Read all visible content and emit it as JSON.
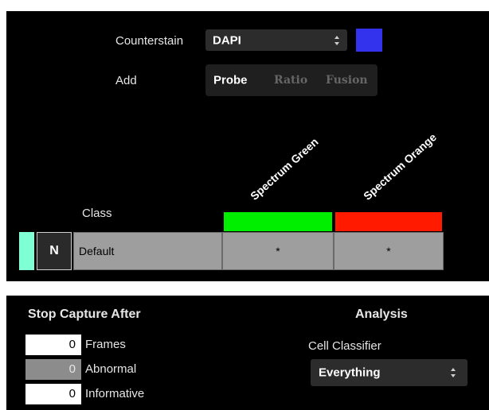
{
  "setup": {
    "counterstain_label": "Counterstain",
    "counterstain_value": "DAPI",
    "counterstain_color": "#3333ee",
    "add_label": "Add",
    "add_options": [
      "Probe",
      "Ratio",
      "Fusion"
    ],
    "add_selected": "Probe"
  },
  "probes": [
    {
      "name": "Spectrum Green",
      "color": "#00ee00"
    },
    {
      "name": "Spectrum Orange",
      "color": "#ff1a00"
    }
  ],
  "class_table": {
    "header": "Class",
    "rows": [
      {
        "swatch_color": "#7fffd4",
        "button": "N",
        "name": "Default",
        "values": [
          "*",
          "*"
        ]
      }
    ]
  },
  "stop_capture": {
    "title": "Stop Capture After",
    "items": [
      {
        "value": "0",
        "label": "Frames",
        "enabled": true
      },
      {
        "value": "0",
        "label": "Abnormal",
        "enabled": false
      },
      {
        "value": "0",
        "label": "Informative",
        "enabled": true
      }
    ]
  },
  "analysis": {
    "title": "Analysis",
    "classifier_label": "Cell Classifier",
    "classifier_value": "Everything"
  }
}
